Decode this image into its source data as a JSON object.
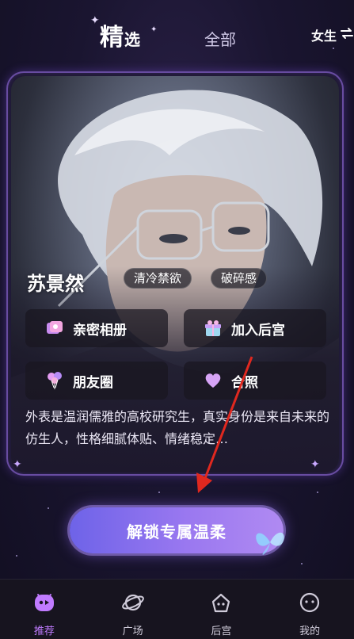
{
  "top_tabs": {
    "selected_tab": {
      "main": "精",
      "small": "选"
    },
    "other_tab": "全部",
    "gender_label": "女生",
    "swap_icon": "swap-arrows-icon"
  },
  "character": {
    "name": "苏景然",
    "tags": [
      "清冷禁欲",
      "破碎感"
    ],
    "features": [
      {
        "label": "亲密相册",
        "icon": "photo-album-icon"
      },
      {
        "label": "加入后宫",
        "icon": "gift-box-icon"
      },
      {
        "label": "朋友圈",
        "icon": "balloons-icon"
      },
      {
        "label": "合照",
        "icon": "heart-icon"
      }
    ],
    "description": "外表是温润儒雅的高校研究生，真实身份是来自未来的仿生人，性格细腻体贴、情绪稳定…"
  },
  "unlock_button": {
    "label": "解锁专属温柔"
  },
  "bottom_nav": [
    {
      "label": "推荐",
      "icon": "recommend-icon",
      "active": true
    },
    {
      "label": "广场",
      "icon": "planet-icon",
      "active": false
    },
    {
      "label": "后宫",
      "icon": "palace-icon",
      "active": false
    },
    {
      "label": "我的",
      "icon": "profile-face-icon",
      "active": false
    }
  ],
  "colors": {
    "accent": "#c07bff",
    "button_start": "#6e63e8",
    "button_end": "#b08af2",
    "background": "#1a1530",
    "annotation_arrow": "#e0281f"
  }
}
